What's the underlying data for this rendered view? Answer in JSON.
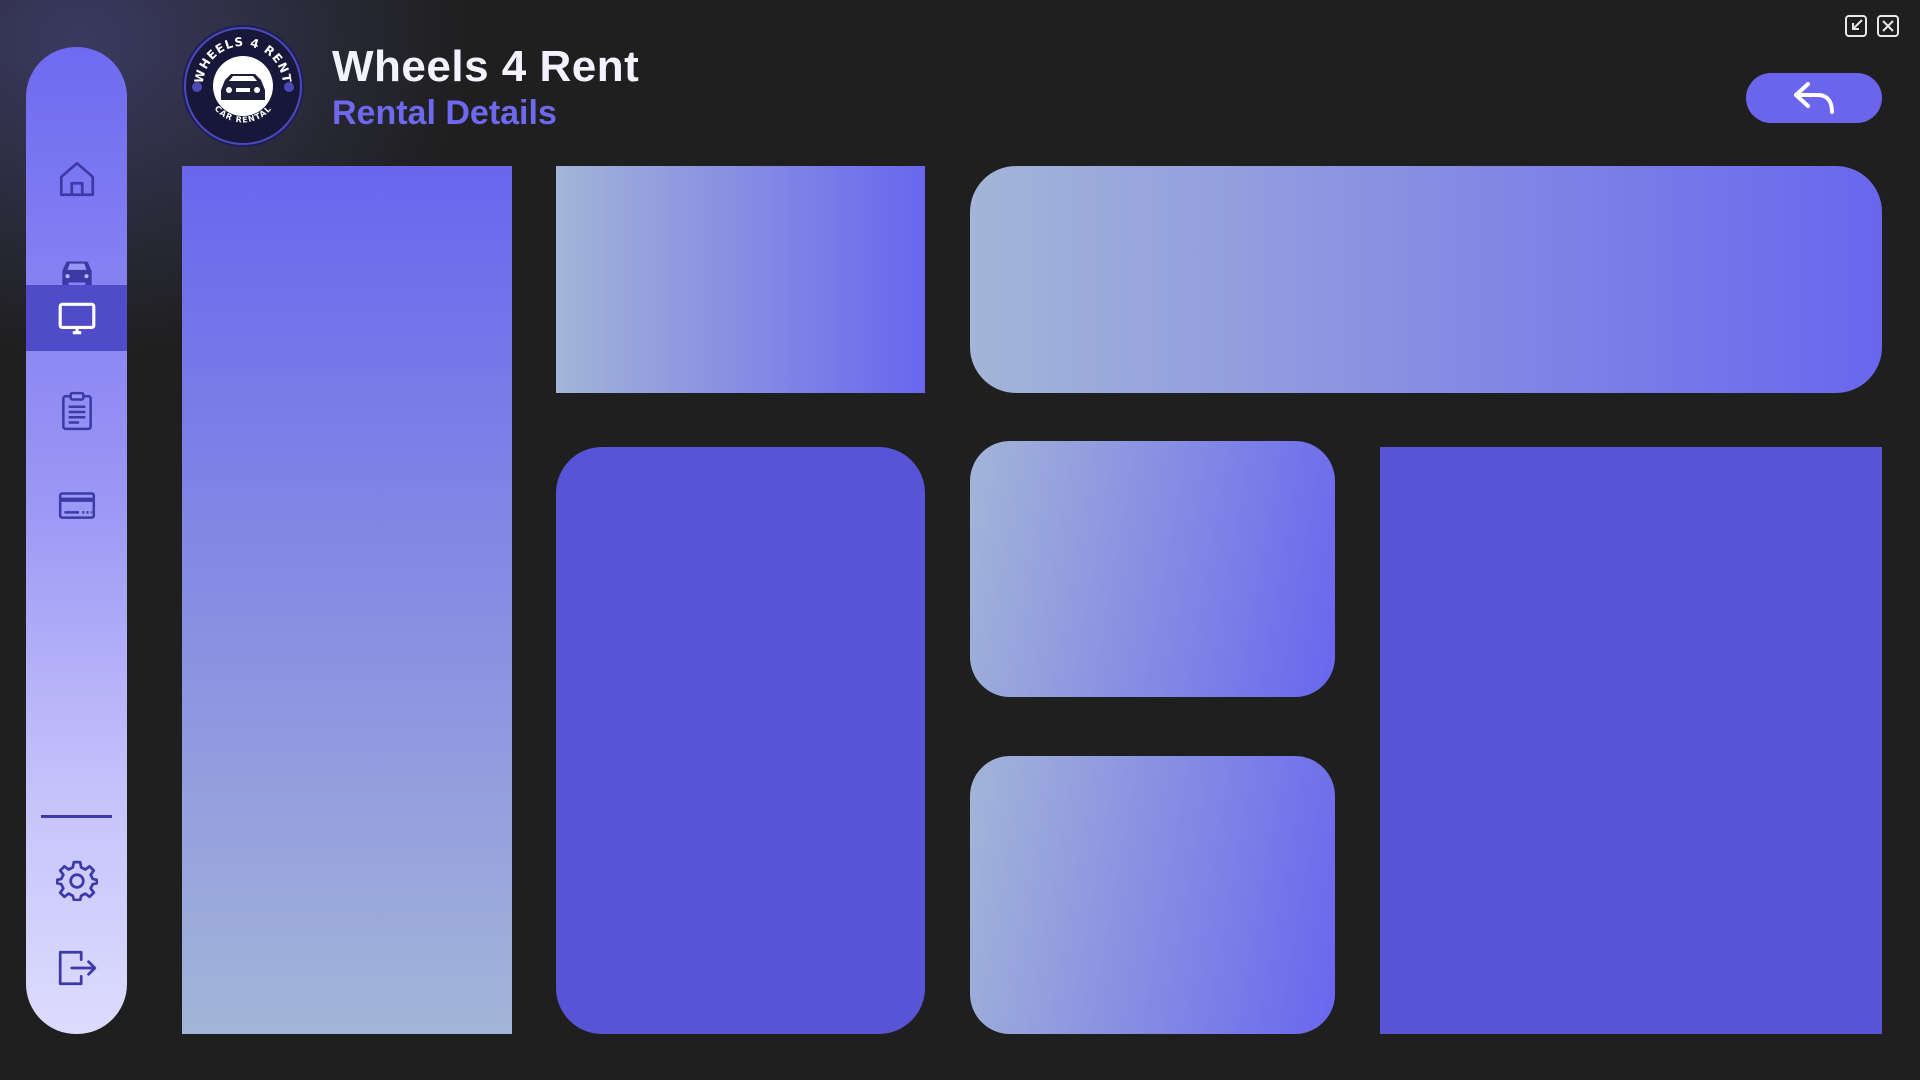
{
  "app": {
    "title": "Wheels 4 Rent",
    "subtitle": "Rental Details"
  },
  "logo": {
    "top_text": "WHEELS 4 RENT",
    "bottom_text": "CAR RENTAL"
  },
  "sidebar": {
    "items": [
      {
        "icon": "home-icon"
      },
      {
        "icon": "car-icon"
      },
      {
        "icon": "monitor-icon",
        "active": true
      },
      {
        "icon": "clipboard-icon"
      },
      {
        "icon": "credit-card-icon"
      }
    ],
    "bottom_items": [
      {
        "icon": "gear-icon"
      },
      {
        "icon": "logout-icon"
      }
    ]
  },
  "window_controls": [
    "minimize-icon",
    "close-icon"
  ],
  "header": {
    "back_icon": "reply-arrow-icon"
  },
  "colors": {
    "background": "#1f1f1f",
    "accent": "#6b65ee",
    "panel_solid": "#5755d6",
    "sidebar_active": "#4f4bc9",
    "gradient_light": "#a3b5d8",
    "icon_stroke": "#3d3aa8"
  }
}
